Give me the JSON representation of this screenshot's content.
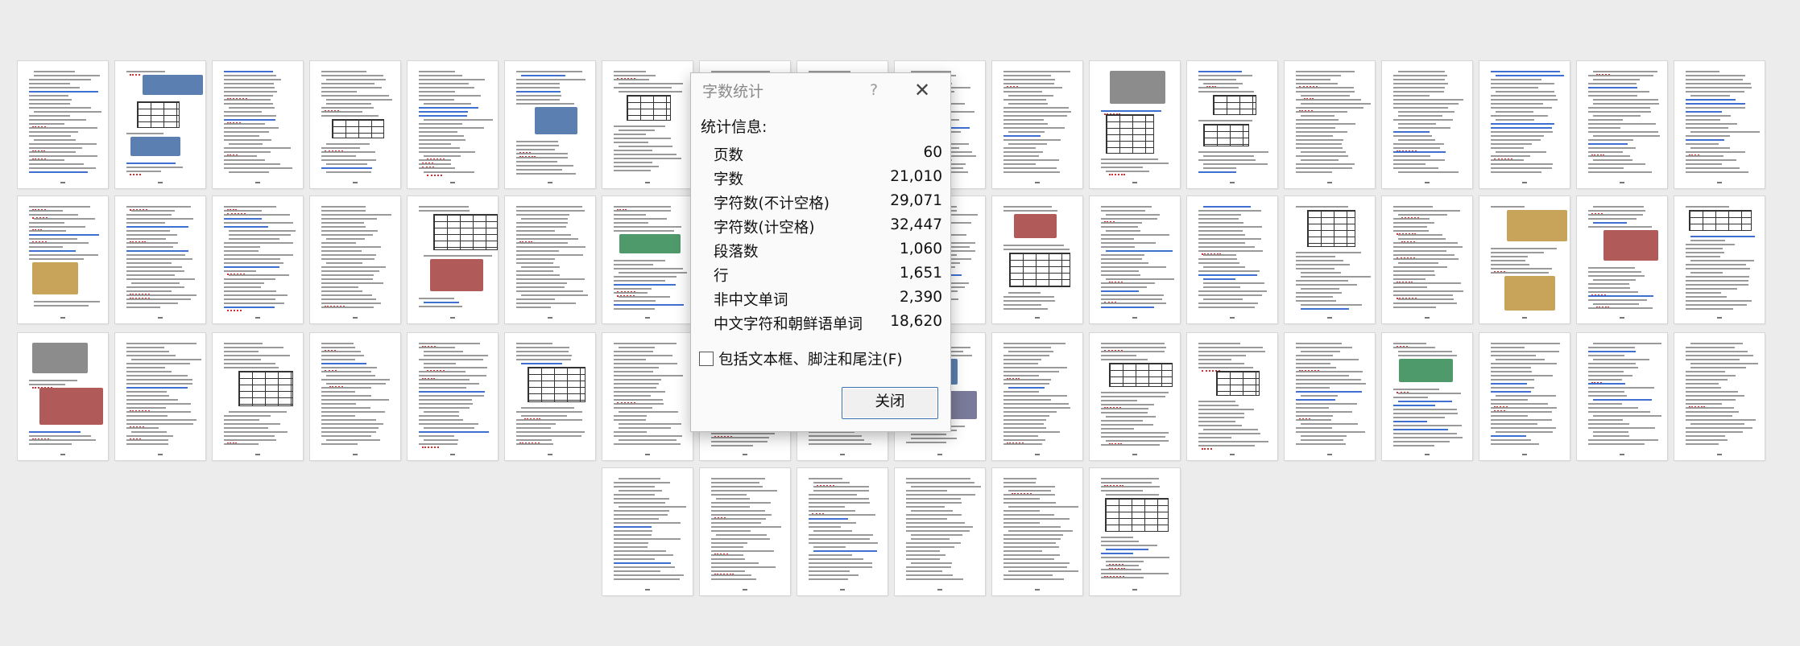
{
  "page_grid": {
    "total_pages": 60
  },
  "dialog": {
    "title": "字数统计",
    "help": "?",
    "close_x": "✕",
    "stats_heading": "统计信息:",
    "stats": [
      {
        "label": "页数",
        "value": "60"
      },
      {
        "label": "字数",
        "value": "21,010"
      },
      {
        "label": "字符数(不计空格)",
        "value": "29,071"
      },
      {
        "label": "字符数(计空格)",
        "value": "32,447"
      },
      {
        "label": "段落数",
        "value": "1,060"
      },
      {
        "label": "行",
        "value": "1,651"
      },
      {
        "label": "非中文单词",
        "value": "2,390"
      },
      {
        "label": "中文字符和朝鲜语单词",
        "value": "18,620"
      }
    ],
    "include_checkbox": {
      "label": "包括文本框、脚注和尾注(F)",
      "checked": false
    },
    "close_button": "关闭"
  }
}
